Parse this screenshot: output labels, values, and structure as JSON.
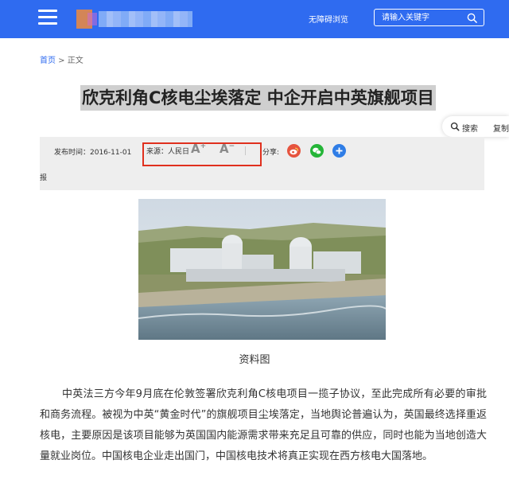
{
  "header": {
    "barrier_free": "无障碍浏览",
    "search_placeholder": "请输入关键字",
    "colors": {
      "bar": "#2f6bf0"
    }
  },
  "breadcrumb": {
    "home": "首页",
    "separator": " > ",
    "current": "正文"
  },
  "article": {
    "title": "欣克利角C核电尘埃落定 中企开启中英旗舰项目",
    "pub_time": "发布时间：2016-11-01",
    "source": "来源：人民日",
    "source_overflow": "报",
    "font_up": "A",
    "font_down": "A",
    "font_up_sign": "+",
    "font_down_sign": "−",
    "share_label": "分享:",
    "caption": "资料图",
    "paragraph": "中英法三方今年9月底在伦敦签署欣克利角C核电项目一揽子协议，至此完成所有必要的审批和商务流程。被视为中英“黄金时代”的旗舰项目尘埃落定，当地舆论普遍认为，英国最终选择重返核电，主要原因是该项目能够为英国国内能源需求带来充足且可靠的供应，同时也能为当地创造大量就业岗位。中国核电企业走出国门，中国核电技术将真正实现在西方核电大国落地。"
  },
  "float_tab": {
    "search": "搜索",
    "copy": "复制"
  },
  "icons": [
    "menu-icon",
    "search-icon",
    "weibo-icon",
    "wechat-icon",
    "plus-share-icon"
  ]
}
